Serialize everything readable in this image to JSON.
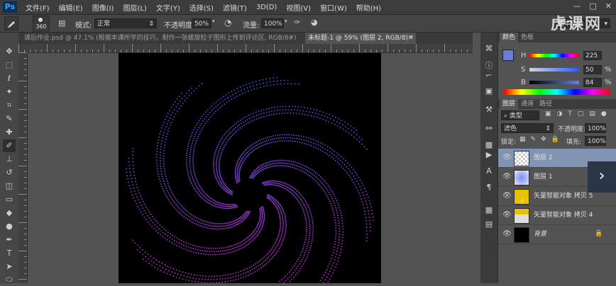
{
  "app": {
    "logo": "Ps",
    "menu": [
      "文件(F)",
      "编辑(E)",
      "图像(I)",
      "图层(L)",
      "文字(Y)",
      "选择(S)",
      "滤镜(T)",
      "3D(D)",
      "视图(V)",
      "窗口(W)",
      "帮助(H)"
    ],
    "window_controls": [
      "—",
      "□",
      "✕"
    ]
  },
  "options_bar": {
    "brush_size": "360",
    "mode_label": "模式:",
    "mode_value": "正常",
    "opacity_label": "不透明度:",
    "opacity_value": "50%",
    "flow_label": "流量:",
    "flow_value": "100%",
    "workspace": "基本功能"
  },
  "watermark": "虎课网",
  "tabs": [
    {
      "label": "课后作业.psd @ 47.1% (根据本课所学的技巧，制作一张螺旋粒子图形上传到评论区, RGB/8#)",
      "active": false
    },
    {
      "label": "未标题-1 @ 59% (图层 2, RGB/8) *",
      "active": true
    }
  ],
  "color_panel": {
    "tabs": [
      "颜色",
      "色板"
    ],
    "rows": [
      {
        "label": "H",
        "value": "225"
      },
      {
        "label": "S",
        "value": "50",
        "unit": "%"
      },
      {
        "label": "B",
        "value": "84",
        "unit": "%"
      }
    ],
    "colors": {
      "foreground": "#6b7fd6",
      "background": "#ffffff"
    }
  },
  "layers_panel": {
    "tabs": [
      "图层",
      "通道",
      "路径"
    ],
    "kind_filter": "类型",
    "blend_mode": "滤色",
    "opacity_label": "不透明度:",
    "opacity_value": "100%",
    "lock_label": "锁定:",
    "fill_label": "填充:",
    "fill_value": "100%",
    "layers": [
      {
        "name": "图层 2",
        "selected": true,
        "thumb": "transparent"
      },
      {
        "name": "图层 1",
        "selected": false,
        "thumb": "blue"
      },
      {
        "name": "矢量智能对象 拷贝 5",
        "selected": false,
        "thumb": "yellow"
      },
      {
        "name": "矢量智能对象 拷贝 4",
        "selected": false,
        "thumb": "yellow-transparent"
      },
      {
        "name": "背景",
        "selected": false,
        "thumb": "black",
        "locked": true
      }
    ]
  }
}
